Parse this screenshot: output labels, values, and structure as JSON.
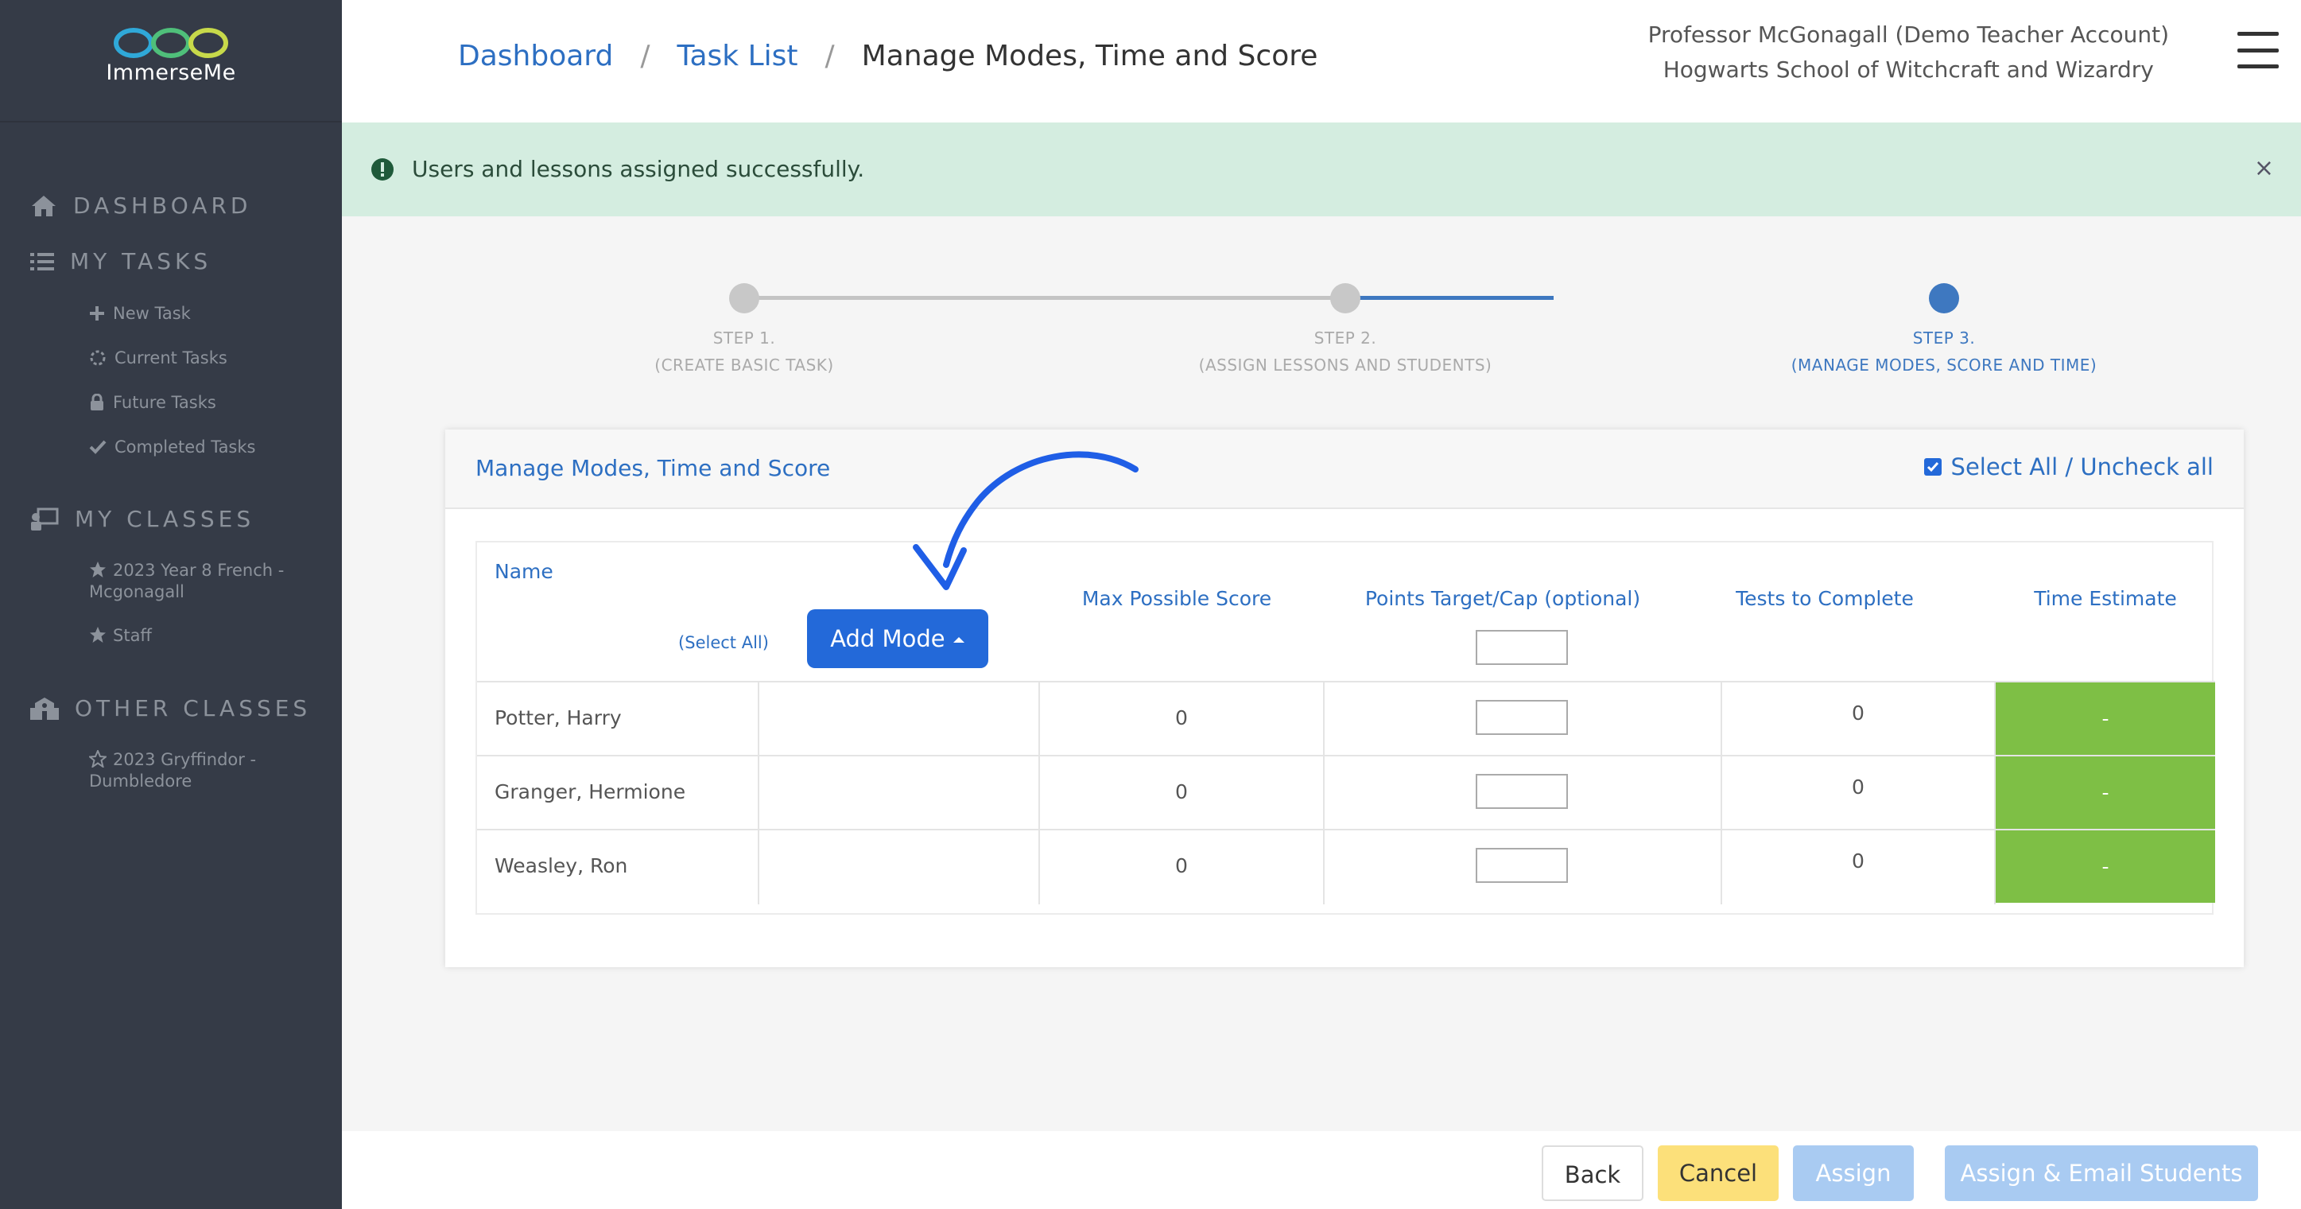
{
  "app": {
    "name": "ImmerseMe"
  },
  "sidebar": {
    "sections": [
      {
        "label": "DASHBOARD",
        "icon": "home-icon"
      },
      {
        "label": "MY TASKS",
        "icon": "task-list-icon"
      },
      {
        "label": "MY CLASSES",
        "icon": "teacher-board-icon"
      },
      {
        "label": "OTHER CLASSES",
        "icon": "school-building-icon"
      }
    ],
    "tasks": [
      {
        "label": "New Task",
        "icon": "plus-icon"
      },
      {
        "label": "Current Tasks",
        "icon": "spinner-icon"
      },
      {
        "label": "Future Tasks",
        "icon": "lock-icon"
      },
      {
        "label": "Completed Tasks",
        "icon": "check-icon"
      }
    ],
    "my_classes": [
      {
        "label": "2023 Year 8 French - Mcgonagall",
        "icon": "star-filled-icon"
      },
      {
        "label": "Staff",
        "icon": "star-filled-icon"
      }
    ],
    "other_classes": [
      {
        "label": "2023 Gryffindor - Dumbledore",
        "icon": "star-outline-icon"
      }
    ]
  },
  "breadcrumb": {
    "dashboard": "Dashboard",
    "sep1": "/",
    "task_list": "Task List",
    "sep2": "/",
    "current": "Manage Modes, Time and Score"
  },
  "user": {
    "name": "Professor McGonagall (Demo Teacher Account)",
    "school": "Hogwarts School of Witchcraft and Wizardry"
  },
  "alert": {
    "message": "Users and lessons assigned successfully.",
    "close": "×",
    "color": "#d4ede0"
  },
  "steps": [
    {
      "title": "STEP 1.",
      "subtitle": "(CREATE BASIC TASK)",
      "active": false
    },
    {
      "title": "STEP 2.",
      "subtitle": "(ASSIGN LESSONS AND STUDENTS)",
      "active": false
    },
    {
      "title": "STEP 3.",
      "subtitle": "(MANAGE MODES, SCORE AND TIME)",
      "active": true
    }
  ],
  "card": {
    "title": "Manage Modes, Time and Score",
    "select_all": "Select All / Uncheck all",
    "select_all_checked": true
  },
  "table": {
    "headers": {
      "name": "Name",
      "select_all": "(Select All)",
      "add_mode": "Add Mode",
      "max_score": "Max Possible Score",
      "points_target": "Points Target/Cap (optional)",
      "tests": "Tests to Complete",
      "time": "Time Estimate"
    },
    "rows": [
      {
        "name": "Potter, Harry",
        "max_score": "0",
        "tests": "0",
        "time": "-"
      },
      {
        "name": "Granger, Hermione",
        "max_score": "0",
        "tests": "0",
        "time": "-"
      },
      {
        "name": "Weasley, Ron",
        "max_score": "0",
        "tests": "0",
        "time": "-"
      }
    ]
  },
  "footer": {
    "back": "Back",
    "cancel": "Cancel",
    "assign": "Assign",
    "assign_email": "Assign & Email Students"
  },
  "colors": {
    "sidebar": "#353b47",
    "primary": "#2369d9",
    "link": "#2d6fc2",
    "time_green": "#7ebf45",
    "cancel_yellow": "#fce07a",
    "disabled_blue": "#a9cbf2"
  }
}
